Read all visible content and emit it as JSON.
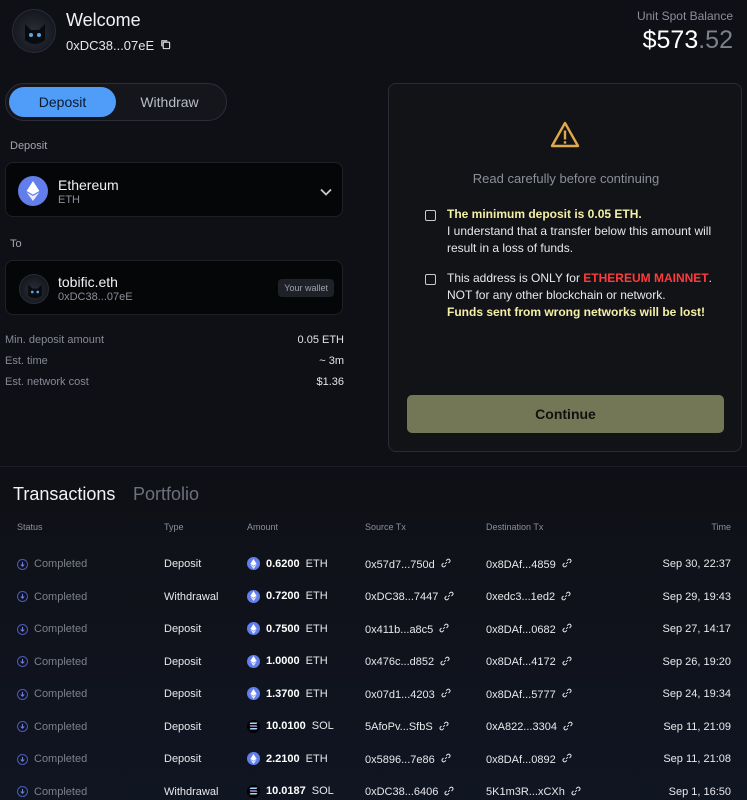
{
  "header": {
    "welcome": "Welcome",
    "address": "0xDC38...07eE",
    "balance_label": "Unit Spot Balance",
    "balance_main": "$573",
    "balance_cents": ".52"
  },
  "tabs": {
    "deposit": "Deposit",
    "withdraw": "Withdraw"
  },
  "deposit_section": {
    "label": "Deposit",
    "token_name": "Ethereum",
    "token_symbol": "ETH"
  },
  "to_section": {
    "label": "To",
    "name": "tobific.eth",
    "address": "0xDC38...07eE",
    "tag": "Your wallet"
  },
  "details": [
    {
      "label": "Min. deposit amount",
      "value": "0.05 ETH"
    },
    {
      "label": "Est. time",
      "value": "~ 3m"
    },
    {
      "label": "Est. network cost",
      "value": "$1.36"
    }
  ],
  "warning": {
    "title": "Read carefully before continuing",
    "item1_bold": "The minimum deposit is 0.05 ETH.",
    "item1_text": "I understand that a transfer below this amount will result in a loss of funds.",
    "item2_prefix": "This address is ONLY for ",
    "item2_red": "ETHEREUM MAINNET",
    "item2_suffix": ".",
    "item2_text": "NOT for any other blockchain or network.",
    "item2_bold": "Funds sent from wrong networks will be lost!",
    "continue": "Continue"
  },
  "tx_tabs": {
    "transactions": "Transactions",
    "portfolio": "Portfolio"
  },
  "table": {
    "headers": {
      "status": "Status",
      "type": "Type",
      "amount": "Amount",
      "source": "Source Tx",
      "dest": "Destination Tx",
      "time": "Time"
    },
    "rows": [
      {
        "status": "Completed",
        "type": "Deposit",
        "amount": "0.6200",
        "token": "ETH",
        "source": "0x57d7...750d",
        "dest": "0x8DAf...4859",
        "time": "Sep 30, 22:37"
      },
      {
        "status": "Completed",
        "type": "Withdrawal",
        "amount": "0.7200",
        "token": "ETH",
        "source": "0xDC38...7447",
        "dest": "0xedc3...1ed2",
        "time": "Sep 29, 19:43"
      },
      {
        "status": "Completed",
        "type": "Deposit",
        "amount": "0.7500",
        "token": "ETH",
        "source": "0x411b...a8c5",
        "dest": "0x8DAf...0682",
        "time": "Sep 27, 14:17"
      },
      {
        "status": "Completed",
        "type": "Deposit",
        "amount": "1.0000",
        "token": "ETH",
        "source": "0x476c...d852",
        "dest": "0x8DAf...4172",
        "time": "Sep 26, 19:20"
      },
      {
        "status": "Completed",
        "type": "Deposit",
        "amount": "1.3700",
        "token": "ETH",
        "source": "0x07d1...4203",
        "dest": "0x8DAf...5777",
        "time": "Sep 24, 19:34"
      },
      {
        "status": "Completed",
        "type": "Deposit",
        "amount": "10.0100",
        "token": "SOL",
        "source": "5AfoPv...SfbS",
        "dest": "0xA822...3304",
        "time": "Sep 11, 21:09"
      },
      {
        "status": "Completed",
        "type": "Deposit",
        "amount": "2.2100",
        "token": "ETH",
        "source": "0x5896...7e86",
        "dest": "0x8DAf...0892",
        "time": "Sep 11, 21:08"
      },
      {
        "status": "Completed",
        "type": "Withdrawal",
        "amount": "10.0187",
        "token": "SOL",
        "source": "0xDC38...6406",
        "dest": "5K1m3R...xCXh",
        "time": "Sep 1, 16:50"
      }
    ]
  }
}
